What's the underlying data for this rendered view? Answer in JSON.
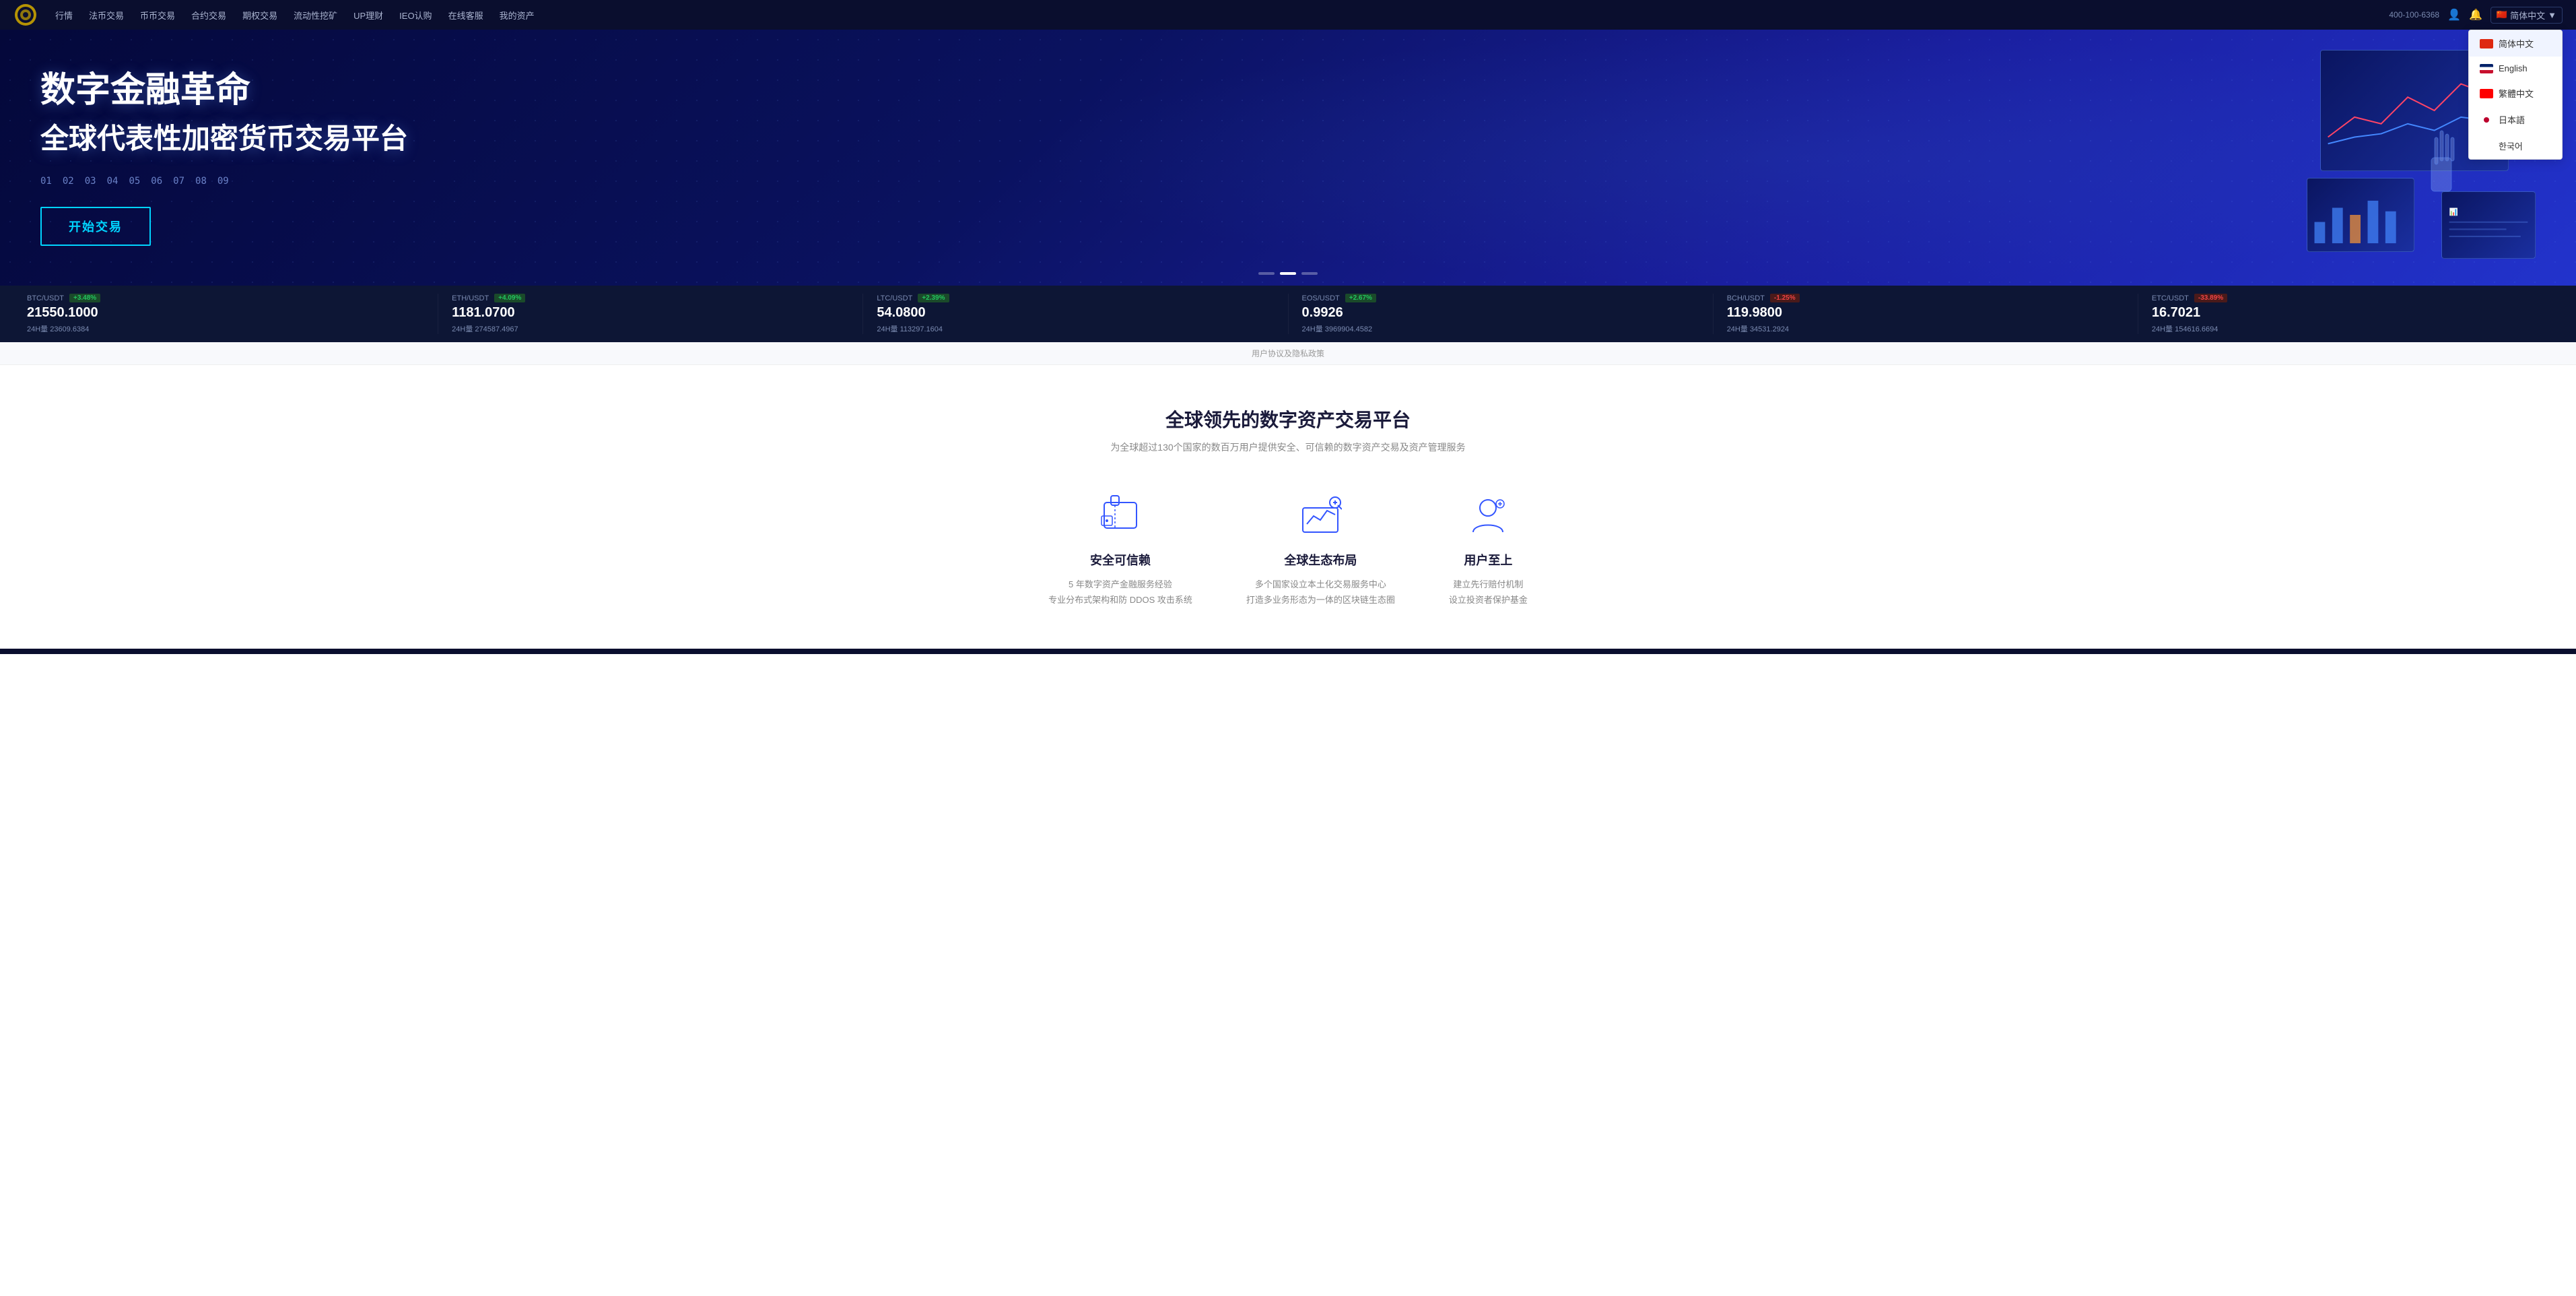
{
  "navbar": {
    "links": [
      {
        "label": "行情",
        "id": "market"
      },
      {
        "label": "法币交易",
        "id": "fiat"
      },
      {
        "label": "币币交易",
        "id": "spot"
      },
      {
        "label": "合约交易",
        "id": "contract"
      },
      {
        "label": "期权交易",
        "id": "options"
      },
      {
        "label": "流动性挖矿",
        "id": "liquidity"
      },
      {
        "label": "UP理财",
        "id": "upfinance"
      },
      {
        "label": "IEO认购",
        "id": "ieo"
      },
      {
        "label": "在线客服",
        "id": "support"
      },
      {
        "label": "我的资产",
        "id": "assets"
      }
    ],
    "phone": "400-100-6368",
    "lang_label": "简体中文"
  },
  "lang_dropdown": {
    "items": [
      {
        "label": "简体中文",
        "flag": "cn",
        "active": true
      },
      {
        "label": "English",
        "flag": "en",
        "active": false
      },
      {
        "label": "繁體中文",
        "flag": "tw",
        "active": false
      },
      {
        "label": "日本語",
        "flag": "jp",
        "active": false
      },
      {
        "label": "한국어",
        "flag": "kr",
        "active": false
      }
    ]
  },
  "hero": {
    "title": "数字金融革命",
    "subtitle": "全球代表性加密货币交易平台",
    "numbers": [
      "01",
      "02",
      "03",
      "04",
      "05",
      "06",
      "07",
      "08",
      "09"
    ],
    "cta_label": "开始交易"
  },
  "ticker": {
    "items": [
      {
        "pair": "BTC/USDT",
        "badge": "+3.48%",
        "positive": true,
        "price": "21550.1000",
        "volume_label": "24H量",
        "volume": "23609.6384"
      },
      {
        "pair": "ETH/USDT",
        "badge": "+4.09%",
        "positive": true,
        "price": "1181.0700",
        "volume_label": "24H量",
        "volume": "274587.4967"
      },
      {
        "pair": "LTC/USDT",
        "badge": "+2.39%",
        "positive": true,
        "price": "54.0800",
        "volume_label": "24H量",
        "volume": "113297.1604"
      },
      {
        "pair": "EOS/USDT",
        "badge": "+2.67%",
        "positive": true,
        "price": "0.9926",
        "volume_label": "24H量",
        "volume": "3969904.4582"
      },
      {
        "pair": "BCH/USDT",
        "badge": "-1.25%",
        "positive": false,
        "price": "119.9800",
        "volume_label": "24H量",
        "volume": "34531.2924"
      },
      {
        "pair": "ETC/USDT",
        "badge": "-33.89%",
        "positive": false,
        "price": "16.7021",
        "volume_label": "24H量",
        "volume": "154616.6694"
      }
    ]
  },
  "notice": {
    "text": "用户协议及隐私政策"
  },
  "features": {
    "title": "全球领先的数字资产交易平台",
    "subtitle": "为全球超过130个国家的数百万用户提供安全、可信赖的数字资产交易及资产管理服务",
    "items": [
      {
        "id": "security",
        "icon": "shield",
        "name": "安全可信赖",
        "desc_lines": [
          "5 年数字资产金融服务经验",
          "专业分布式架构和防 DDOS 攻击系统"
        ]
      },
      {
        "id": "ecosystem",
        "icon": "chart",
        "name": "全球生态布局",
        "desc_lines": [
          "多个国家设立本土化交易服务中心",
          "打造多业务形态为一体的区块链生态圈"
        ]
      },
      {
        "id": "user",
        "icon": "user",
        "name": "用户至上",
        "desc_lines": [
          "建立先行赔付机制",
          "设立投资者保护基金"
        ]
      }
    ]
  }
}
